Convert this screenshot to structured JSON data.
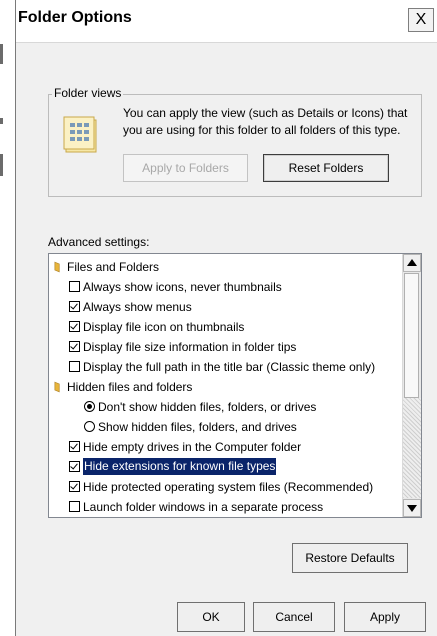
{
  "title": "Folder Options",
  "close_glyph": "X",
  "folder_views": {
    "legend": "Folder views",
    "description": "You can apply the view (such as Details or Icons) that you are using for this folder to all folders of this type.",
    "apply_button": "Apply to Folders",
    "reset_button": "Reset Folders"
  },
  "advanced": {
    "label": "Advanced settings:",
    "items": [
      {
        "type": "folder",
        "label": "Files and Folders"
      },
      {
        "type": "checkbox",
        "checked": false,
        "label": "Always show icons, never thumbnails"
      },
      {
        "type": "checkbox",
        "checked": true,
        "label": "Always show menus"
      },
      {
        "type": "checkbox",
        "checked": true,
        "label": "Display file icon on thumbnails"
      },
      {
        "type": "checkbox",
        "checked": true,
        "label": "Display file size information in folder tips"
      },
      {
        "type": "checkbox",
        "checked": false,
        "label": "Display the full path in the title bar (Classic theme only)"
      },
      {
        "type": "folder",
        "label": "Hidden files and folders"
      },
      {
        "type": "radio",
        "checked": true,
        "label": "Don't show hidden files, folders, or drives"
      },
      {
        "type": "radio",
        "checked": false,
        "label": "Show hidden files, folders, and drives"
      },
      {
        "type": "checkbox",
        "checked": true,
        "label": "Hide empty drives in the Computer folder"
      },
      {
        "type": "checkbox",
        "checked": true,
        "selected": true,
        "label": "Hide extensions for known file types"
      },
      {
        "type": "checkbox",
        "checked": true,
        "label": "Hide protected operating system files (Recommended)"
      },
      {
        "type": "checkbox",
        "checked": false,
        "label": "Launch folder windows in a separate process"
      }
    ]
  },
  "buttons": {
    "restore": "Restore Defaults",
    "ok": "OK",
    "cancel": "Cancel",
    "apply": "Apply"
  },
  "icons": {
    "close": "close-icon",
    "folder_view": "folder-view-icon",
    "tree_folder": "folder-icon",
    "scroll_up": "scroll-up-arrow-icon",
    "scroll_down": "scroll-down-arrow-icon"
  },
  "colors": {
    "selection_bg": "#0a246a",
    "dialog_bg": "#f0f0f0",
    "folder_yellow": "#e8b53a"
  }
}
